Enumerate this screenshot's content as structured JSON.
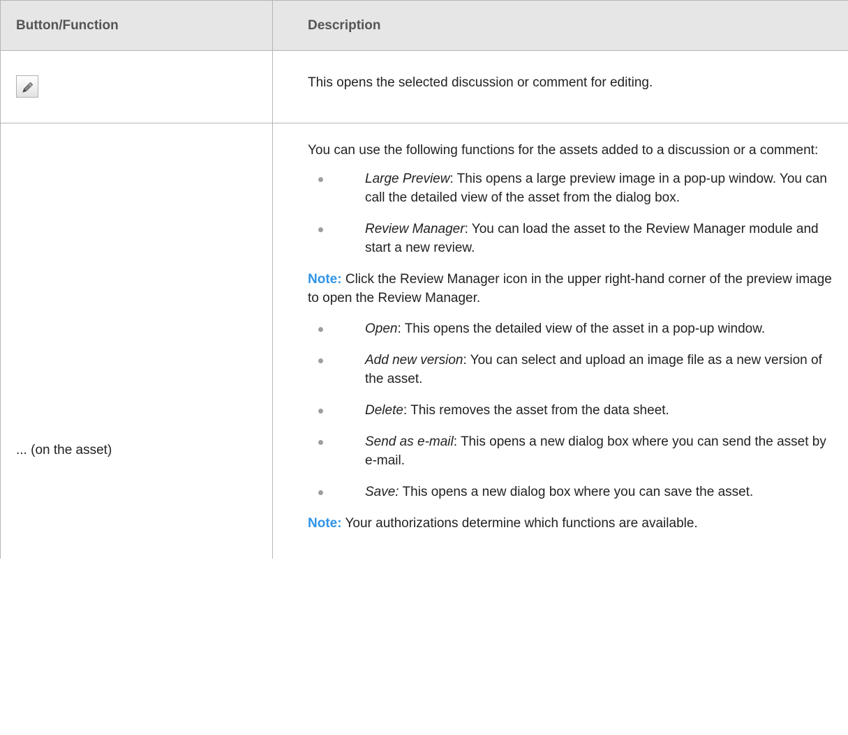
{
  "table": {
    "headers": [
      "Button/Function",
      "Description"
    ],
    "edit_row": {
      "icon": "pencil-icon",
      "description": "This opens the selected discussion or comment for editing."
    },
    "asset_row": {
      "function": "... (on the asset)",
      "intro": "You can use the following functions for the assets added to a discussion or a comment:",
      "items_group1": [
        {
          "term": "Large Preview",
          "sep": ":",
          "text": " This opens a large preview image in a pop-up window. You can call the detailed view of the asset from the dialog box."
        },
        {
          "term": "Review Manager",
          "sep": ":",
          "text": " You can load the asset to the Review Manager module and start a new review."
        }
      ],
      "note1": {
        "label": "Note:",
        "text": " Click the Review Manager icon in the upper right-hand corner of the preview image to open the Review Manager."
      },
      "items_group2": [
        {
          "term": "Open",
          "sep": ":",
          "text": " This opens the detailed view of the asset in a pop-up window."
        },
        {
          "term": "Add new version",
          "sep": ":",
          "text": " You can select and upload an image file as a new version of the asset."
        },
        {
          "term": "Delete",
          "sep": ":",
          "text": " This removes the asset from the data sheet."
        },
        {
          "term": "Send as e-mail",
          "sep": ":",
          "text": " This opens a new dialog box where you can send the asset by e-mail."
        },
        {
          "term": "Save:",
          "sep": "",
          "text": " This opens a new dialog box where you can save the asset."
        }
      ],
      "note2": {
        "label": "Note:",
        "text": " Your authorizations determine which functions are available."
      }
    }
  },
  "colors": {
    "header_bg": "#e6e6e6",
    "note_label": "#2f95e8",
    "border": "#b5b5b5"
  }
}
